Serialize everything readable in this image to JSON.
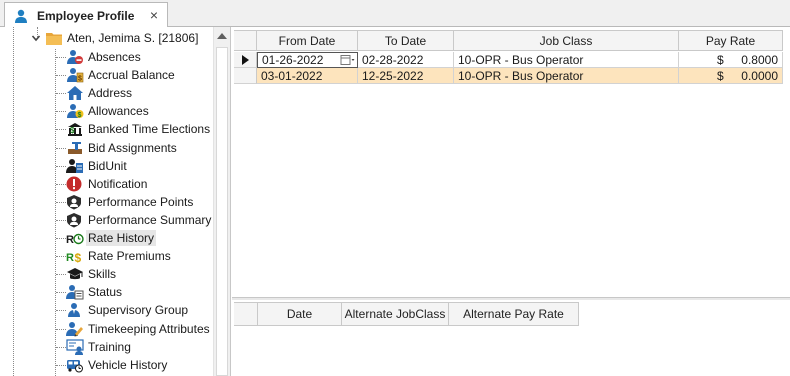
{
  "tab": {
    "title": "Employee Profile",
    "close_glyph": "×",
    "icon": "user-icon"
  },
  "tree": {
    "root": {
      "label": "Aten, Jemima S. [21806]",
      "expanded": true,
      "icon": "folder-icon"
    },
    "items": [
      {
        "label": "Absences",
        "icon": "absences-icon"
      },
      {
        "label": "Accrual Balance",
        "icon": "accrual-balance-icon"
      },
      {
        "label": "Address",
        "icon": "address-icon"
      },
      {
        "label": "Allowances",
        "icon": "allowances-icon"
      },
      {
        "label": "Banked Time Elections",
        "icon": "banked-time-icon"
      },
      {
        "label": "Bid Assignments",
        "icon": "bid-assignments-icon"
      },
      {
        "label": "BidUnit",
        "icon": "bidunit-icon"
      },
      {
        "label": "Notification",
        "icon": "notification-icon"
      },
      {
        "label": "Performance Points",
        "icon": "performance-points-icon"
      },
      {
        "label": "Performance Summary",
        "icon": "performance-summary-icon"
      },
      {
        "label": "Rate History",
        "icon": "rate-history-icon",
        "selected": true
      },
      {
        "label": "Rate Premiums",
        "icon": "rate-premiums-icon"
      },
      {
        "label": "Skills",
        "icon": "skills-icon"
      },
      {
        "label": "Status",
        "icon": "status-icon"
      },
      {
        "label": "Supervisory Group",
        "icon": "supervisory-group-icon"
      },
      {
        "label": "Timekeeping Attributes",
        "icon": "timekeeping-icon"
      },
      {
        "label": "Training",
        "icon": "training-icon"
      },
      {
        "label": "Vehicle History",
        "icon": "vehicle-history-icon"
      }
    ]
  },
  "rate_grid": {
    "columns": [
      "From Date",
      "To Date",
      "Job Class",
      "Pay Rate"
    ],
    "rows": [
      {
        "from_date": "01-26-2022",
        "to_date": "02-28-2022",
        "job_class": "10-OPR - Bus Operator",
        "currency": "$",
        "pay_rate": "0.8000",
        "current": true
      },
      {
        "from_date": "03-01-2022",
        "to_date": "12-25-2022",
        "job_class": "10-OPR - Bus Operator",
        "currency": "$",
        "pay_rate": "0.0000",
        "current": false
      }
    ]
  },
  "alt_grid": {
    "columns": [
      "Date",
      "Alternate JobClass",
      "Alternate Pay Rate"
    ]
  },
  "colors": {
    "alt_row": "#fde4bd",
    "header_bg": "#f4f4f4",
    "selection_bg": "#e6e6e6"
  }
}
